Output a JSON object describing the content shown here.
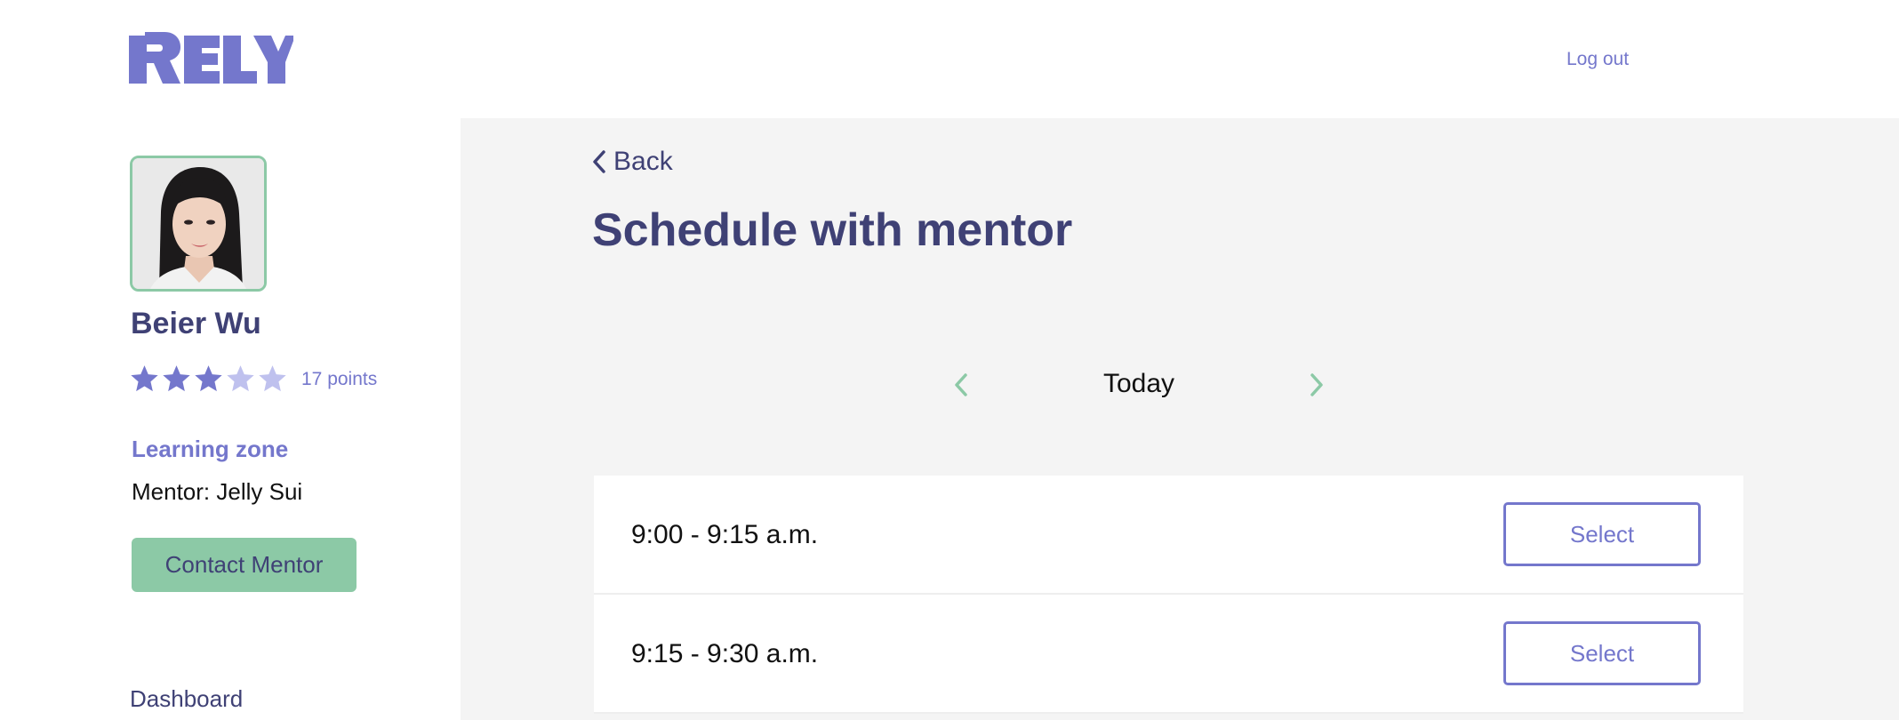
{
  "header": {
    "logo_text": "RELY",
    "logout_label": "Log out"
  },
  "profile": {
    "name": "Beier Wu",
    "rating": 3,
    "max_rating": 5,
    "points_label": "17 points",
    "learning_zone_title": "Learning zone",
    "mentor_line": "Mentor: Jelly Sui",
    "contact_label": "Contact Mentor"
  },
  "nav": {
    "dashboard_label": "Dashboard"
  },
  "main": {
    "back_label": "Back",
    "title": "Schedule with mentor",
    "date_label": "Today",
    "slots": [
      {
        "time": "9:00 - 9:15 a.m.",
        "button_label": "Select"
      },
      {
        "time": "9:15 - 9:30 a.m.",
        "button_label": "Select"
      }
    ]
  },
  "colors": {
    "brand": "#7477cc",
    "navy": "#3f4175",
    "accent_green": "#8cc9a6",
    "star_filled": "#7477cc",
    "star_empty": "#bfc1ee",
    "main_bg": "#f4f4f4"
  }
}
